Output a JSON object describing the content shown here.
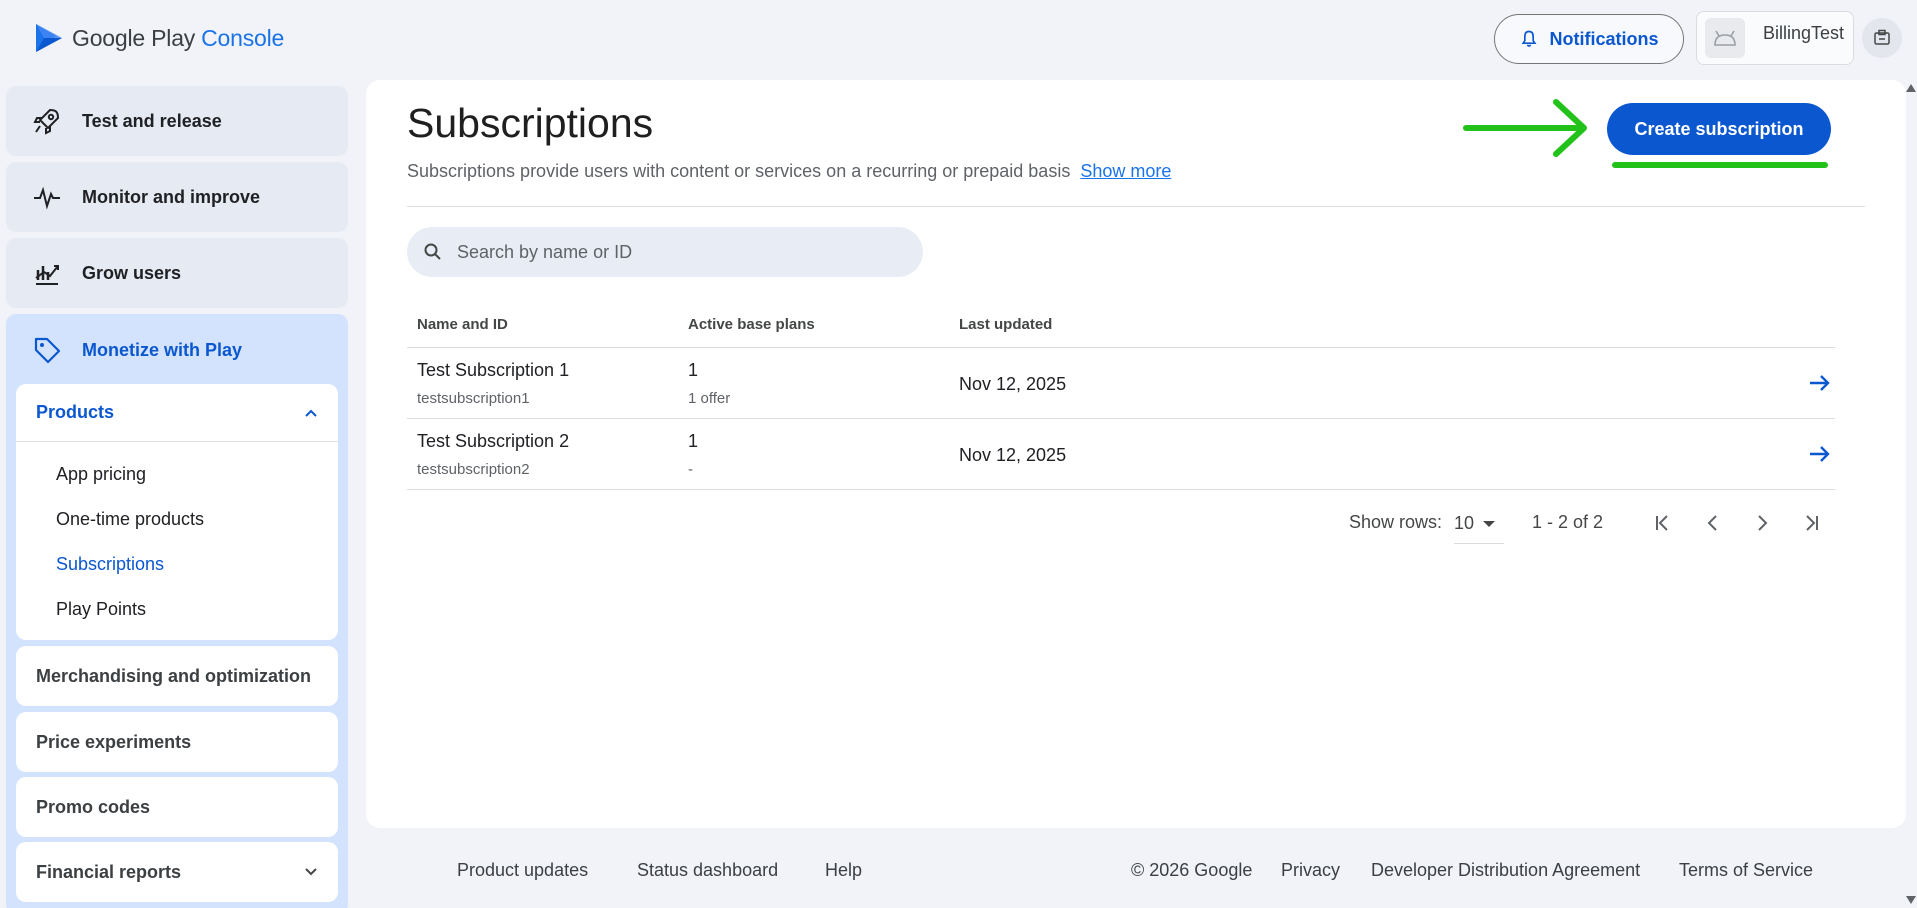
{
  "header": {
    "logo_google_play": "Google Play",
    "logo_console": "Console",
    "notifications_label": "Notifications",
    "app_name": "BillingTest"
  },
  "sidebar": {
    "nav": [
      {
        "label": "Test and release",
        "icon": "rocket-icon"
      },
      {
        "label": "Monitor and improve",
        "icon": "pulse-icon"
      },
      {
        "label": "Grow users",
        "icon": "growth-chart-icon"
      }
    ],
    "monetize": {
      "label": "Monetize with Play",
      "icon": "tag-icon",
      "products": {
        "label": "Products",
        "items": [
          "App pricing",
          "One-time products",
          "Subscriptions",
          "Play Points"
        ],
        "active": "Subscriptions"
      },
      "groups": [
        "Merchandising and optimization",
        "Price experiments",
        "Promo codes",
        "Financial reports"
      ]
    }
  },
  "main": {
    "title": "Subscriptions",
    "description": "Subscriptions provide users with content or services on a recurring or prepaid basis",
    "show_more": "Show more",
    "create_button": "Create subscription",
    "search": {
      "placeholder": "Search by name or ID",
      "value": ""
    },
    "table": {
      "columns": [
        "Name and ID",
        "Active base plans",
        "Last updated"
      ],
      "rows": [
        {
          "name": "Test Subscription 1",
          "id": "testsubscription1",
          "plans": "1",
          "offers": "1 offer",
          "updated": "Nov 12, 2025"
        },
        {
          "name": "Test Subscription 2",
          "id": "testsubscription2",
          "plans": "1",
          "offers": "-",
          "updated": "Nov 12, 2025"
        }
      ]
    },
    "pagination": {
      "rows_label": "Show rows:",
      "rows_value": "10",
      "range": "1 - 2 of 2"
    }
  },
  "footer": {
    "links": [
      "Product updates",
      "Status dashboard",
      "Help"
    ],
    "copyright": "© 2026 Google",
    "legal": [
      "Privacy",
      "Developer Distribution Agreement",
      "Terms of Service"
    ]
  },
  "colors": {
    "primary": "#0b57d0",
    "annotation": "#23c21b",
    "sidebar_active_bg": "#d3e3fd"
  }
}
